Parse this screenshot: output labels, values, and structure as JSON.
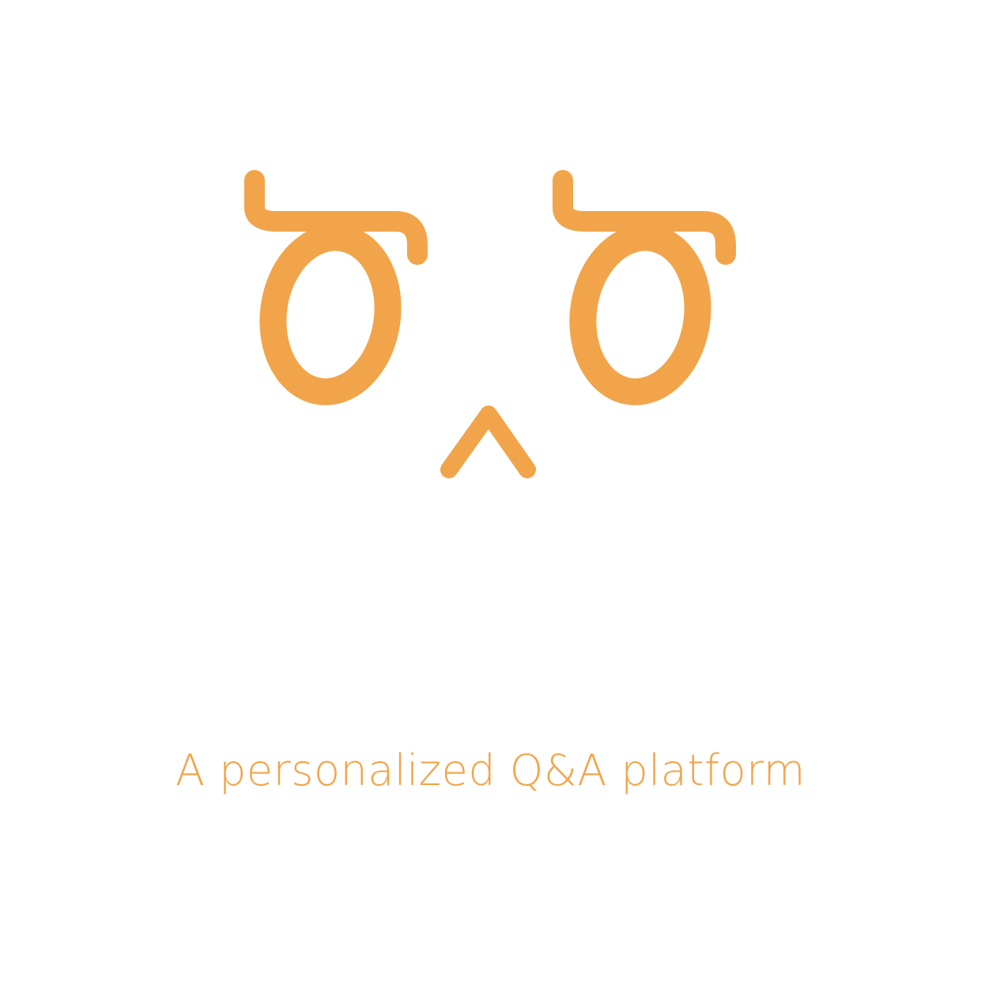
{
  "splash": {
    "tagline": "A personalized Q&A platform",
    "logo_icon": "owl-face-icon"
  },
  "colors": {
    "background": "#ffffff",
    "brand_orange": "#F2A44A"
  }
}
